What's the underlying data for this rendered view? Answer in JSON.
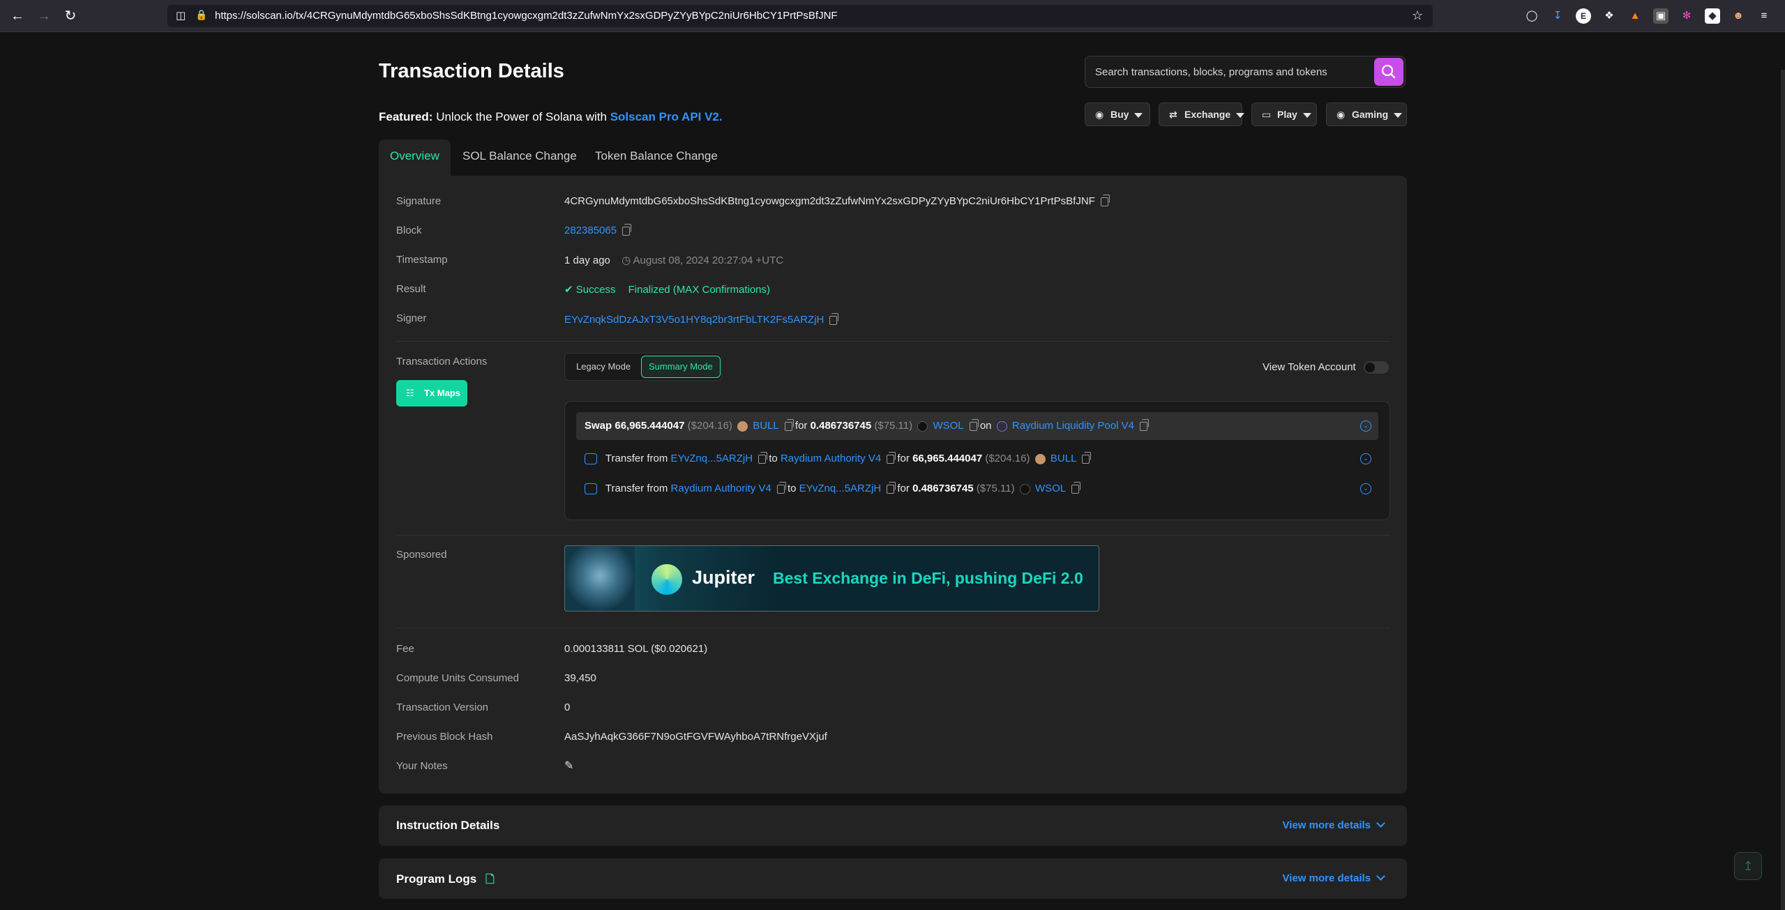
{
  "browser": {
    "url": "https://solscan.io/tx/4CRGynuMdymtdbG65xboShsSdKBtng1cyowgcxgm2dt3zZufwNmYx2sxGDPyZYyBYpC2niUr6HbCY1PrtPsBfJNF"
  },
  "header": {
    "title": "Transaction Details",
    "search_placeholder": "Search transactions, blocks, programs and tokens",
    "featured_label": "Featured:",
    "featured_text": "Unlock the Power of Solana with",
    "featured_link": "Solscan Pro API V2.",
    "menus": [
      "Buy",
      "Exchange",
      "Play",
      "Gaming"
    ]
  },
  "tabs": [
    "Overview",
    "SOL Balance Change",
    "Token Balance Change"
  ],
  "overview": {
    "signature_label": "Signature",
    "signature": "4CRGynuMdymtdbG65xboShsSdKBtng1cyowgcxgm2dt3zZufwNmYx2sxGDPyZYyBYpC2niUr6HbCY1PrtPsBfJNF",
    "block_label": "Block",
    "block": "282385065",
    "timestamp_label": "Timestamp",
    "timestamp_relative": "1 day ago",
    "timestamp_absolute": "August 08, 2024 20:27:04 +UTC",
    "result_label": "Result",
    "result_status": "Success",
    "result_finality": "Finalized (MAX Confirmations)",
    "signer_label": "Signer",
    "signer": "EYvZnqkSdDzAJxT3V5o1HY8q2br3rtFbLTK2Fs5ARZjH",
    "actions_label": "Transaction Actions",
    "tx_maps": "Tx Maps",
    "legacy_mode": "Legacy Mode",
    "summary_mode": "Summary Mode",
    "view_token_account": "View Token Account",
    "swap": {
      "verb": "Swap",
      "amount_in": "66,965.444047",
      "usd_in": "($204.16)",
      "token_in": "BULL",
      "for": "for",
      "amount_out": "0.486736745",
      "usd_out": "($75.11)",
      "token_out": "WSOL",
      "on": "on",
      "pool": "Raydium Liquidity Pool V4"
    },
    "transfers": [
      {
        "label": "Transfer from",
        "from": "EYvZnq...5ARZjH",
        "to_word": "to",
        "to": "Raydium Authority V4",
        "for": "for",
        "amount": "66,965.444047",
        "usd": "($204.16)",
        "token": "BULL"
      },
      {
        "label": "Transfer from",
        "from": "Raydium Authority V4",
        "to_word": "to",
        "to": "EYvZnq...5ARZjH",
        "for": "for",
        "amount": "0.486736745",
        "usd": "($75.11)",
        "token": "WSOL"
      }
    ],
    "sponsored_label": "Sponsored",
    "banner_brand": "Jupiter",
    "banner_slogan": "Best Exchange in DeFi, pushing DeFi 2.0",
    "fee_label": "Fee",
    "fee": "0.000133811 SOL ($0.020621)",
    "cu_label": "Compute Units Consumed",
    "cu": "39,450",
    "version_label": "Transaction Version",
    "version": "0",
    "prev_hash_label": "Previous Block Hash",
    "prev_hash": "AaSJyhAqkG366F7N9oGtFGVFWAyhboA7tRNfrgeVXjuf",
    "notes_label": "Your Notes"
  },
  "sections": {
    "instruction_details": "Instruction Details",
    "program_logs": "Program Logs",
    "view_more": "View more details"
  },
  "colors": {
    "accent_green": "#2ee6a8",
    "link_blue": "#2f95ff",
    "search_purple": "#c84ee8"
  }
}
